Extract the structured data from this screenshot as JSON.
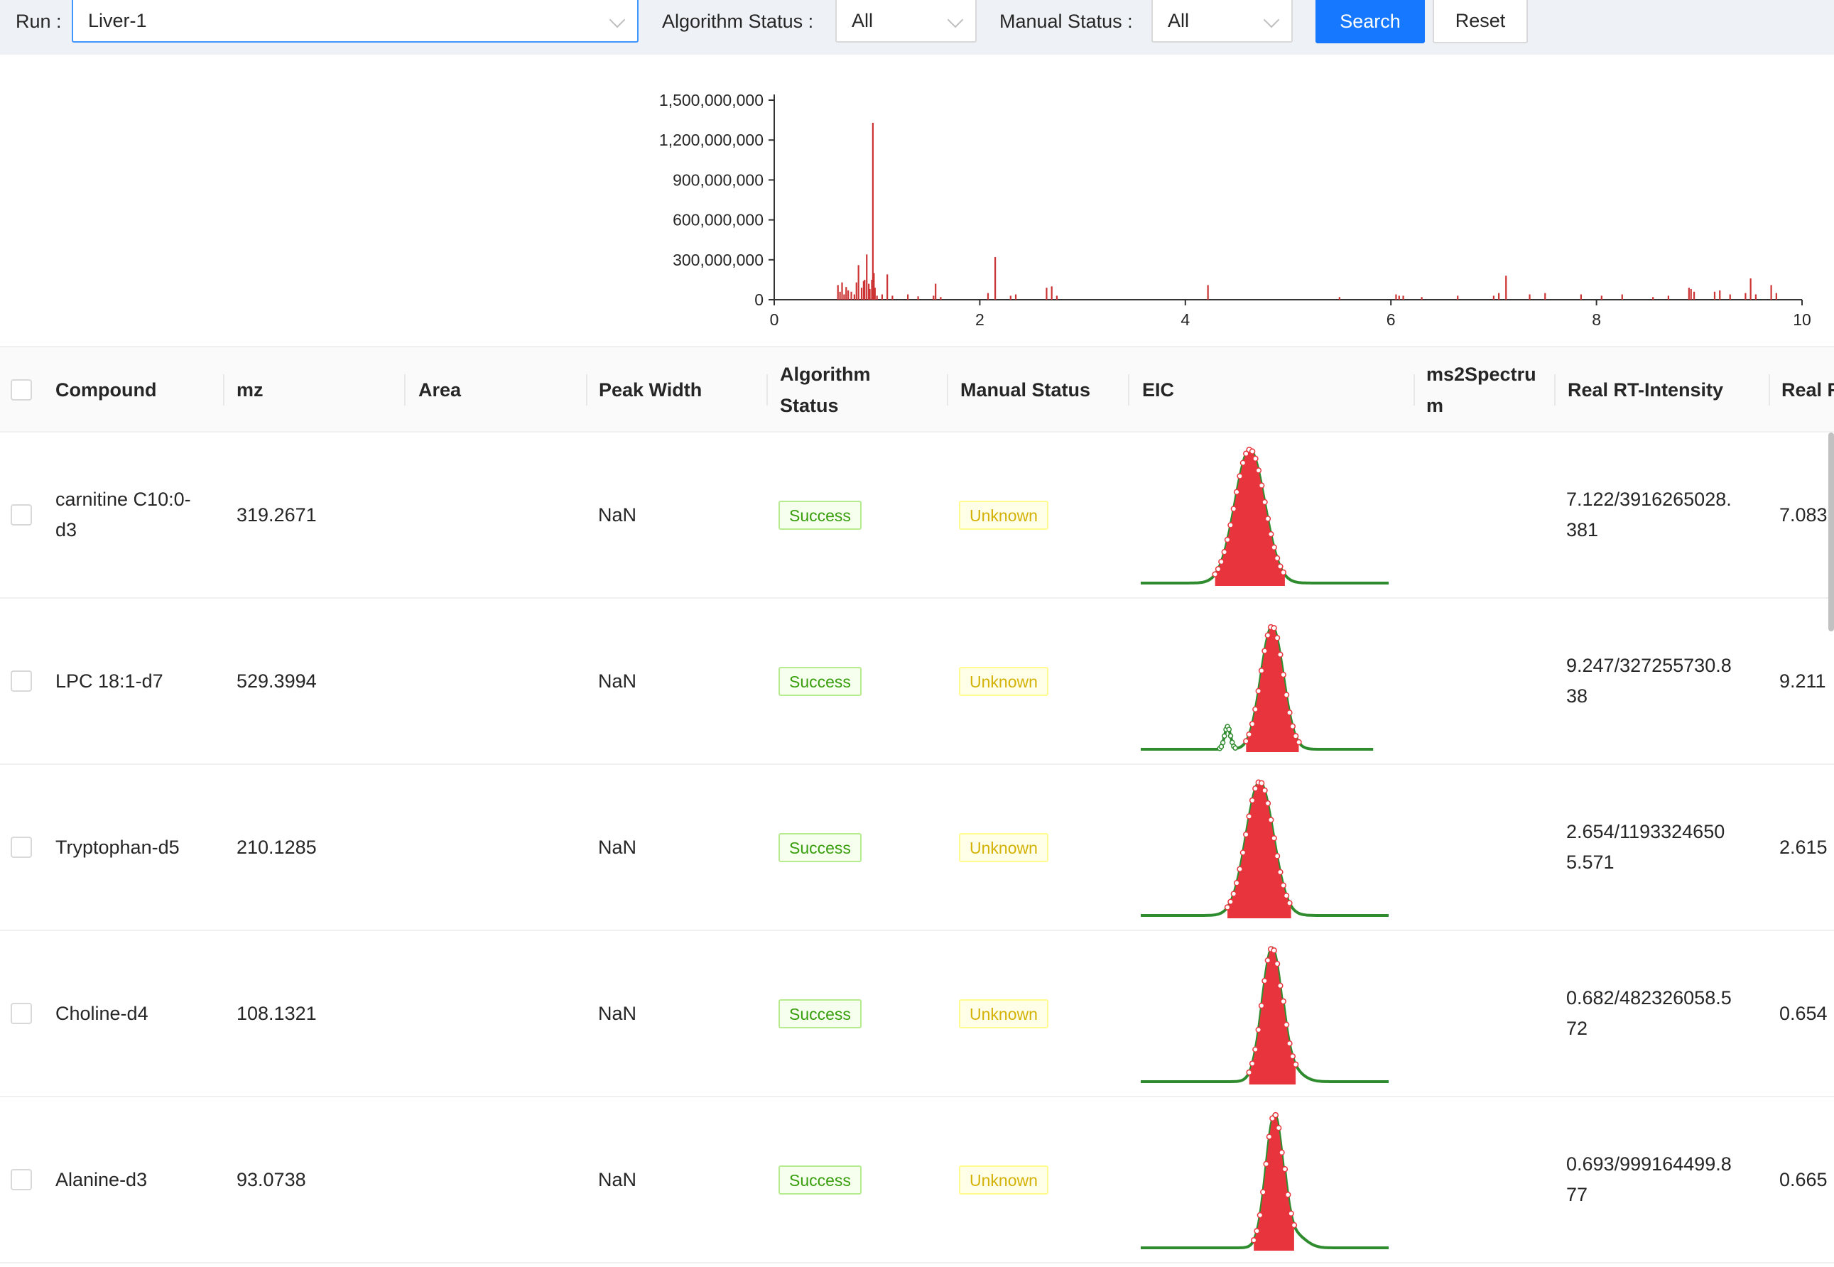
{
  "toolbar": {
    "run_label": "Run",
    "run_value": "Liver-1",
    "algorithm_status_label": "Algorithm Status",
    "algorithm_status_value": "All",
    "manual_status_label": "Manual Status",
    "manual_status_value": "All",
    "search_label": "Search",
    "reset_label": "Reset"
  },
  "colors": {
    "primary": "#1677ff",
    "bar": "#cc3333",
    "peak_fill": "#e8343c",
    "eic_line": "#2e8b2e",
    "success": "#389e0d",
    "unknown": "#d4b106"
  },
  "chart_data": {
    "type": "bar",
    "title": "",
    "xlabel": "",
    "ylabel": "",
    "xlim": [
      0,
      10
    ],
    "ylim": [
      0,
      1500000000
    ],
    "x_ticks": [
      "0",
      "2",
      "4",
      "6",
      "8",
      "10"
    ],
    "y_ticks": [
      "0",
      "300,000,000",
      "600,000,000",
      "900,000,000",
      "1,200,000,000",
      "1,500,000,000"
    ],
    "series": [
      {
        "x": [
          0.62,
          0.64,
          0.66,
          0.68,
          0.7,
          0.72,
          0.75,
          0.78,
          0.8,
          0.82,
          0.85,
          0.87,
          0.88,
          0.9,
          0.92,
          0.93,
          0.95,
          0.96,
          0.97,
          0.98,
          1.0,
          1.05,
          1.1,
          1.15,
          1.3,
          1.4,
          1.55,
          1.57,
          1.62,
          2.08,
          2.15,
          2.3,
          2.35,
          2.65,
          2.7,
          2.75,
          4.22,
          5.5,
          6.05,
          6.08,
          6.12,
          6.3,
          6.65,
          7.0,
          7.05,
          7.12,
          7.35,
          7.5,
          7.85,
          8.05,
          8.25,
          8.55,
          8.7,
          8.9,
          8.92,
          8.95,
          9.15,
          9.2,
          9.3,
          9.45,
          9.5,
          9.55,
          9.7,
          9.75
        ],
        "values": [
          110000000,
          60000000,
          130000000,
          40000000,
          95000000,
          70000000,
          60000000,
          40000000,
          130000000,
          260000000,
          90000000,
          140000000,
          150000000,
          340000000,
          120000000,
          80000000,
          150000000,
          1330000000,
          200000000,
          90000000,
          30000000,
          40000000,
          190000000,
          30000000,
          40000000,
          25000000,
          30000000,
          120000000,
          20000000,
          50000000,
          320000000,
          30000000,
          40000000,
          90000000,
          100000000,
          30000000,
          110000000,
          20000000,
          40000000,
          30000000,
          30000000,
          20000000,
          30000000,
          30000000,
          50000000,
          180000000,
          40000000,
          50000000,
          40000000,
          30000000,
          40000000,
          20000000,
          30000000,
          90000000,
          80000000,
          60000000,
          60000000,
          70000000,
          40000000,
          50000000,
          160000000,
          40000000,
          110000000,
          50000000
        ]
      }
    ]
  },
  "table": {
    "headers": {
      "compound": "Compound",
      "mz": "mz",
      "area": "Area",
      "peak_width": "Peak Width",
      "algorithm_status_line1": "Algorithm",
      "algorithm_status_line2": "Status",
      "manual_status": "Manual Status",
      "eic": "EIC",
      "ms2_line1": "ms2Spectru",
      "ms2_line2": "m",
      "real_rt_intensity": "Real RT-Intensity",
      "real_cut": "Real F"
    },
    "rows": [
      {
        "compound_line1": "carnitine C10:0-",
        "compound_line2": "d3",
        "mz": "319.2671",
        "area": "",
        "peak_width": "NaN",
        "algorithm_status": "Success",
        "manual_status": "Unknown",
        "rt_line1": "7.122/3916265028.",
        "rt_line2": "381",
        "next_col": "7.083",
        "eic": {
          "peak_rt": 0.44,
          "peak_width": 0.06,
          "peak_height": 1.0,
          "baseline_start": 0.0,
          "baseline_end": 1.0,
          "secondary": null,
          "tail": 0.0
        }
      },
      {
        "compound_line1": "LPC 18:1-d7",
        "compound_line2": "",
        "mz": "529.3994",
        "area": "",
        "peak_width": "NaN",
        "algorithm_status": "Success",
        "manual_status": "Unknown",
        "rt_line1": "9.247/327255730.8",
        "rt_line2": "38",
        "next_col": "9.211",
        "eic": {
          "peak_rt": 0.53,
          "peak_width": 0.045,
          "peak_height": 0.92,
          "baseline_start": 0.0,
          "baseline_end": 0.94,
          "secondary": {
            "rt": 0.35,
            "height": 0.17
          },
          "tail": 0.0
        }
      },
      {
        "compound_line1": "Tryptophan-d5",
        "compound_line2": "",
        "mz": "210.1285",
        "area": "",
        "peak_width": "NaN",
        "algorithm_status": "Success",
        "manual_status": "Unknown",
        "rt_line1": "2.654/1193324650",
        "rt_line2": "5.571",
        "next_col": "2.615",
        "eic": {
          "peak_rt": 0.48,
          "peak_width": 0.055,
          "peak_height": 1.0,
          "baseline_start": 0.0,
          "baseline_end": 1.0,
          "secondary": null,
          "tail": 0.0
        }
      },
      {
        "compound_line1": "Choline-d4",
        "compound_line2": "",
        "mz": "108.1321",
        "area": "",
        "peak_width": "NaN",
        "algorithm_status": "Success",
        "manual_status": "Unknown",
        "rt_line1": "0.682/482326058.5",
        "rt_line2": "72",
        "next_col": "0.654",
        "eic": {
          "peak_rt": 0.53,
          "peak_width": 0.04,
          "peak_height": 1.0,
          "baseline_start": 0.0,
          "baseline_end": 1.0,
          "secondary": null,
          "tail": 0.07
        }
      },
      {
        "compound_line1": "Alanine-d3",
        "compound_line2": "",
        "mz": "93.0738",
        "area": "",
        "peak_width": "NaN",
        "algorithm_status": "Success",
        "manual_status": "Unknown",
        "rt_line1": "0.693/999164499.8",
        "rt_line2": "77",
        "next_col": "0.665",
        "eic": {
          "peak_rt": 0.54,
          "peak_width": 0.035,
          "peak_height": 1.0,
          "baseline_start": 0.0,
          "baseline_end": 1.0,
          "secondary": null,
          "tail": 0.09
        }
      }
    ]
  }
}
